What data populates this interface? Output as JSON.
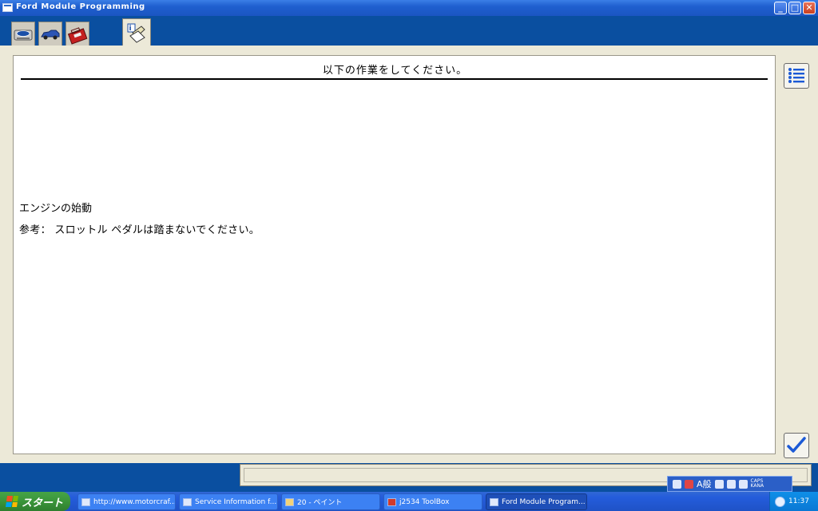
{
  "window": {
    "title": "Ford Module Programming",
    "min_label": "_",
    "max_label": "□",
    "close_label": "✕"
  },
  "toolbar": {
    "tabs": [
      {
        "name": "vehicle-id-tab",
        "icon": "ford-badge-icon"
      },
      {
        "name": "vehicle-tab",
        "icon": "car-icon"
      },
      {
        "name": "toolbox-tab",
        "icon": "toolbox-icon"
      },
      {
        "name": "info-tab",
        "icon": "info-pointer-icon"
      }
    ]
  },
  "panel": {
    "title": "以下の作業をしてください。",
    "message_line1": "エンジンの始動",
    "message_line2": "参考： スロットル ペダルは踏まないでください。"
  },
  "buttons": {
    "list_icon": "list-icon",
    "check_icon": "check-icon"
  },
  "langbar": {
    "mode_label": "A般",
    "caps_label": "CAPS",
    "kana_label": "KANA"
  },
  "taskbar": {
    "start_label": "スタート",
    "tasks": [
      {
        "label": "http://www.motorcraf..."
      },
      {
        "label": "Service Information f..."
      },
      {
        "label": "20 - ペイント"
      },
      {
        "label": "j2534 ToolBox"
      },
      {
        "label": "Ford Module Program..."
      }
    ],
    "clock": "11:37"
  },
  "colors": {
    "app_blue": "#0a4fa0",
    "panel_bg": "#ece9d8",
    "check_blue": "#1c5ad6"
  }
}
